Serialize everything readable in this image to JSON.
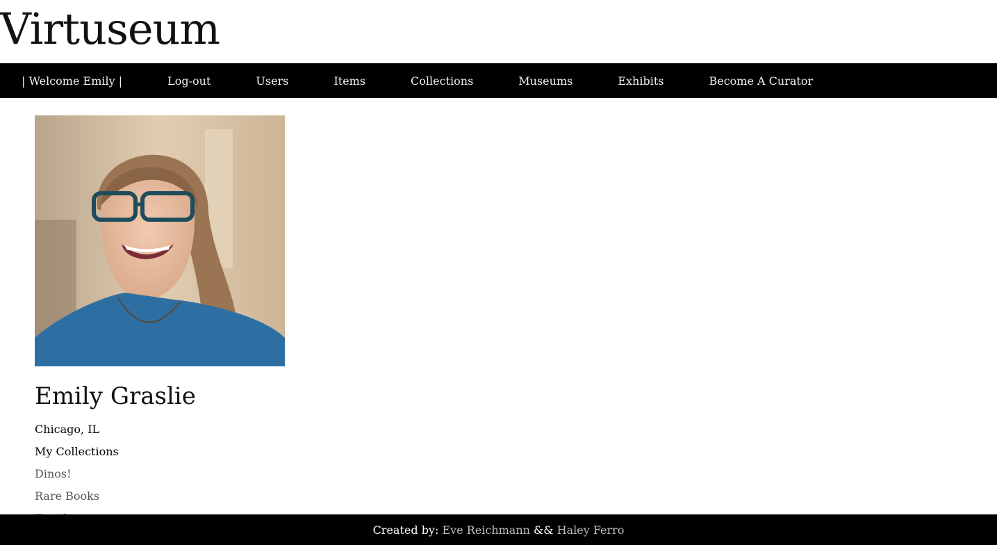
{
  "site": {
    "title": "Virtuseum"
  },
  "nav": {
    "welcome": "| Welcome Emily |",
    "items": [
      "Log-out",
      "Users",
      "Items",
      "Collections",
      "Museums",
      "Exhibits",
      "Become A Curator"
    ]
  },
  "profile": {
    "name": "Emily Graslie",
    "location": "Chicago, IL",
    "collections_heading": "My Collections",
    "collections": [
      "Dinos!",
      "Rare Books",
      "Fossils"
    ]
  },
  "footer": {
    "prefix": "Created by: ",
    "author1": "Eve Reichmann",
    "separator": " && ",
    "author2": "Haley Ferro"
  },
  "colors": {
    "nav_background": "#000000",
    "nav_text": "#f0f0f0",
    "footer_link": "#bdbdbd",
    "collection_link": "#555555"
  }
}
